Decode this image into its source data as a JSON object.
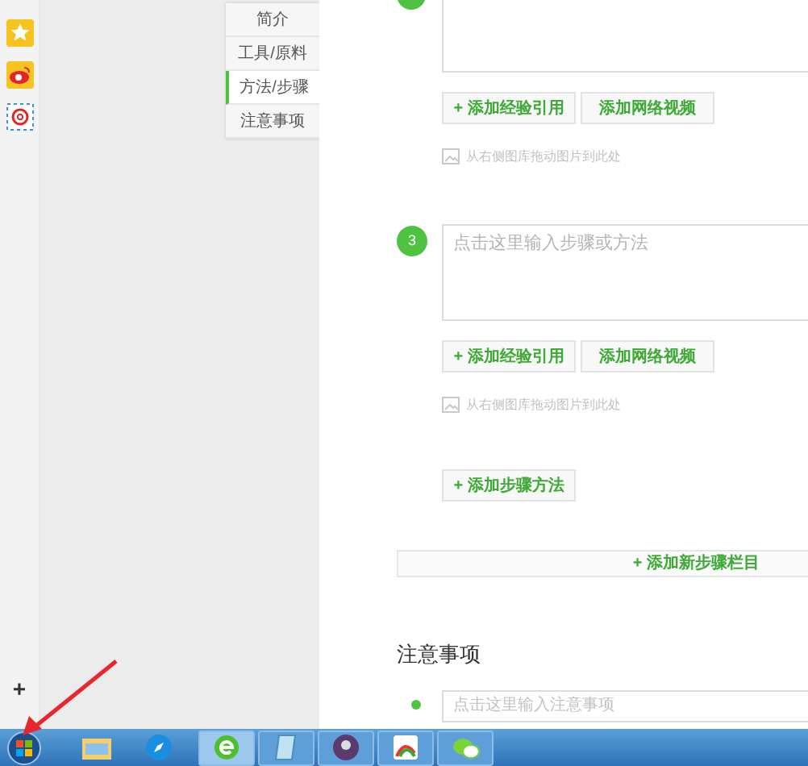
{
  "side_toolbar": {
    "add_label": "+"
  },
  "nav": [
    {
      "label": "简介",
      "selected": false
    },
    {
      "label": "工具/原料",
      "selected": false
    },
    {
      "label": "方法/步骤",
      "selected": true
    },
    {
      "label": "注意事项",
      "selected": false
    }
  ],
  "steps": [
    {
      "kind": "partial",
      "buttons": [
        "+ 添加经验引用",
        "添加网络视频"
      ],
      "image_hint": "从右侧图库拖动图片到此处"
    },
    {
      "kind": "full",
      "number": "3",
      "placeholder": "点击这里输入步骤或方法",
      "buttons": [
        "+ 添加经验引用",
        "添加网络视频"
      ],
      "image_hint": "从右侧图库拖动图片到此处"
    }
  ],
  "add_step_button": "+ 添加步骤方法",
  "add_section_button": "+ 添加新步骤栏目",
  "notes": {
    "heading": "注意事项",
    "placeholder": "点击这里输入注意事项"
  }
}
